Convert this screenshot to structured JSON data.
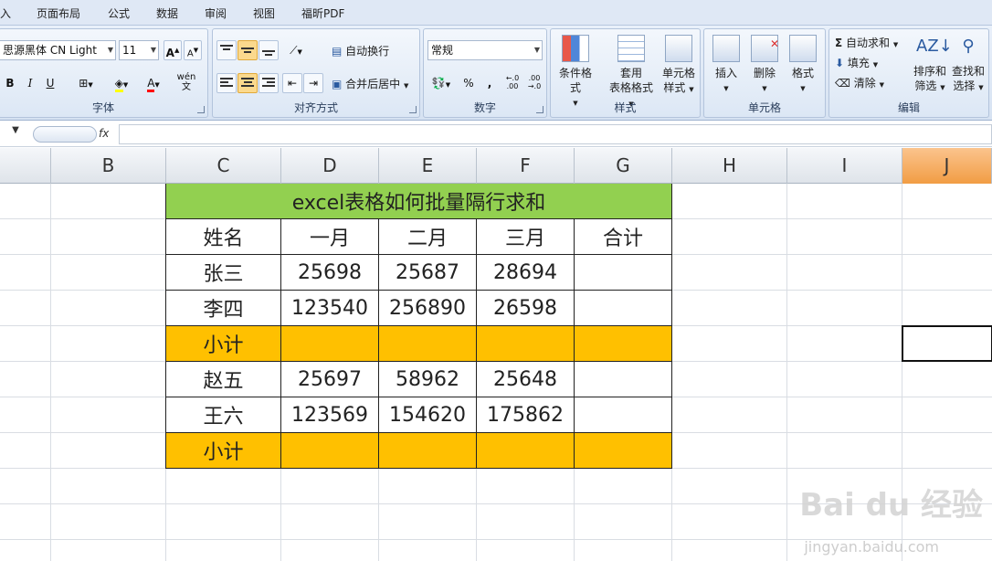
{
  "menu": [
    "入",
    "页面布局",
    "公式",
    "数据",
    "审阅",
    "视图",
    "福昕PDF"
  ],
  "ribbon": {
    "font": {
      "label": "字体",
      "font_name": "思源黑体 CN Light",
      "font_size": "11",
      "grow": "A",
      "shrink": "A",
      "bold": "B",
      "italic": "I",
      "underline": "U",
      "font_color_letter": "A",
      "phonetic": "wén\n文"
    },
    "alignment": {
      "label": "对齐方式",
      "wrap": "自动换行",
      "merge": "合并后居中"
    },
    "number": {
      "label": "数字",
      "format": "常规",
      "percent": "%",
      "comma": ","
    },
    "styles": {
      "label": "样式",
      "cond": "条件格式",
      "table1": "套用",
      "table2": "表格格式",
      "cellstyle1": "单元格",
      "cellstyle2": "样式"
    },
    "cells": {
      "label": "单元格",
      "insert": "插入",
      "delete": "删除",
      "format": "格式"
    },
    "editing": {
      "label": "编辑",
      "autosum": "自动求和",
      "fill": "填充",
      "clear": "清除",
      "sort1": "排序和",
      "sort2": "筛选",
      "find1": "查找和",
      "find2": "选择"
    }
  },
  "formula": {
    "fx": "fx",
    "value": ""
  },
  "columns": [
    "B",
    "C",
    "D",
    "E",
    "F",
    "G",
    "H",
    "I",
    "J"
  ],
  "sheet": {
    "title": "excel表格如何批量隔行求和",
    "header": [
      "姓名",
      "一月",
      "二月",
      "三月",
      "合计"
    ],
    "rows": [
      [
        "张三",
        "25698",
        "25687",
        "28694",
        ""
      ],
      [
        "李四",
        "123540",
        "256890",
        "26598",
        ""
      ],
      [
        "小计",
        "",
        "",
        "",
        ""
      ],
      [
        "赵五",
        "25697",
        "58962",
        "25648",
        ""
      ],
      [
        "王六",
        "123569",
        "154620",
        "175862",
        ""
      ],
      [
        "小计",
        "",
        "",
        "",
        ""
      ]
    ]
  },
  "colors": {
    "title_fill": "#92d050",
    "subtotal_fill": "#ffc000",
    "selected_col": "#f19d44"
  },
  "watermark": {
    "brand": "Bai du 经验",
    "url": "jingyan.baidu.com"
  }
}
